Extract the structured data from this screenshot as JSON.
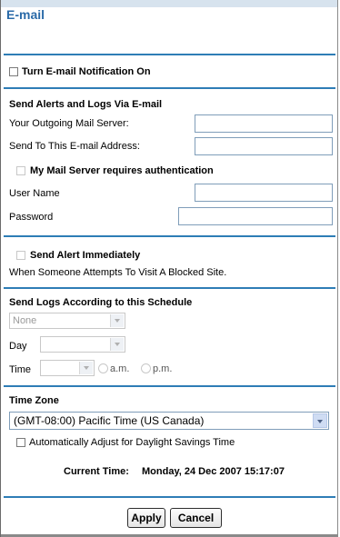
{
  "page": {
    "title": "E-mail"
  },
  "notification": {
    "label": "Turn E-mail Notification On",
    "checked": false
  },
  "alerts_logs": {
    "heading": "Send Alerts and Logs Via E-mail",
    "outgoing_server_label": "Your Outgoing Mail Server:",
    "outgoing_server_value": "",
    "send_to_label": "Send To This E-mail Address:",
    "send_to_value": "",
    "auth_label": "My Mail Server requires authentication",
    "username_label": "User Name",
    "username_value": "",
    "password_label": "Password",
    "password_value": ""
  },
  "alert": {
    "label": "Send Alert Immediately",
    "description": "When Someone Attempts To Visit A Blocked Site."
  },
  "schedule": {
    "heading": "Send Logs According to this Schedule",
    "frequency_value": "None",
    "day_label": "Day",
    "day_value": "",
    "time_label": "Time",
    "time_value": "",
    "am_label": "a.m.",
    "pm_label": "p.m."
  },
  "timezone": {
    "heading": "Time Zone",
    "selected": "(GMT-08:00) Pacific Time (US Canada)",
    "dst_label": "Automatically Adjust for Daylight Savings Time",
    "current_time_label": "Current Time:",
    "current_time_value": "Monday, 24 Dec 2007 15:17:07"
  },
  "buttons": {
    "apply": "Apply",
    "cancel": "Cancel"
  },
  "colors": {
    "title": "#2a6aa8",
    "divider": "#2e7db6",
    "top_band": "#d7e3ee"
  }
}
